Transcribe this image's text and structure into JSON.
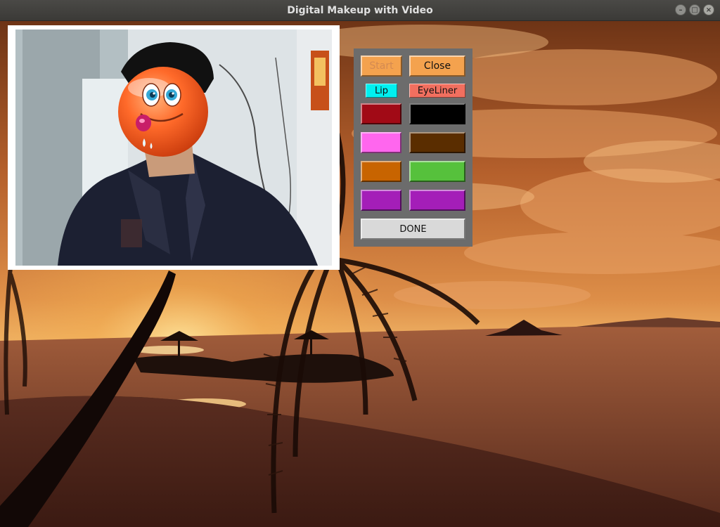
{
  "window": {
    "title": "Digital Makeup with Video"
  },
  "controls": {
    "start_label": "Start",
    "close_label": "Close",
    "lip_label": "Lip",
    "eyeliner_label": "EyeLiner",
    "done_label": "DONE",
    "start_color": "#f4a24e",
    "close_color": "#f4a24e",
    "lip_color": "#00f0f0",
    "eyeliner_color": "#f26f5f",
    "done_color": "#d9d9d9"
  },
  "swatches": [
    {
      "name": "dark-red",
      "color": "#a10a16"
    },
    {
      "name": "black",
      "color": "#000000"
    },
    {
      "name": "pink",
      "color": "#ff66ee"
    },
    {
      "name": "brown",
      "color": "#5a2d00"
    },
    {
      "name": "orange",
      "color": "#c86400"
    },
    {
      "name": "green",
      "color": "#56c13c"
    },
    {
      "name": "purple",
      "color": "#a41eb8"
    },
    {
      "name": "purple",
      "color": "#a41eb8"
    }
  ],
  "icons": {
    "emoji": "smiley-emoji-icon"
  }
}
